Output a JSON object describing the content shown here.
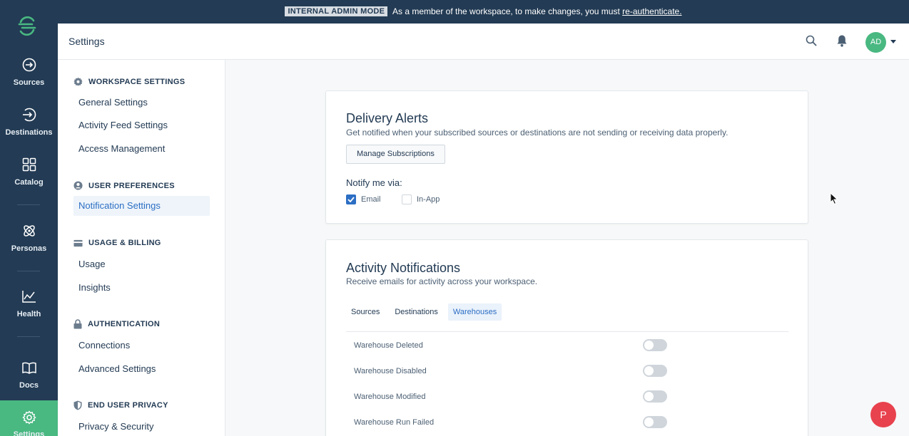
{
  "banner": {
    "mode": "INTERNAL ADMIN MODE",
    "message": "As a member of the workspace, to make changes, you must",
    "link": "re-authenticate."
  },
  "rail": {
    "items": [
      {
        "label": "Sources",
        "icon": "sources-icon"
      },
      {
        "label": "Destinations",
        "icon": "destinations-icon"
      },
      {
        "label": "Catalog",
        "icon": "catalog-icon"
      },
      {
        "label": "Personas",
        "icon": "personas-icon"
      },
      {
        "label": "Health",
        "icon": "health-icon"
      },
      {
        "label": "Docs",
        "icon": "docs-icon"
      },
      {
        "label": "Settings",
        "icon": "gear-icon"
      }
    ],
    "active_color": "#49b881"
  },
  "header": {
    "title": "Settings",
    "avatar_initials": "AD"
  },
  "sidebar": {
    "sections": [
      {
        "title": "WORKSPACE SETTINGS",
        "links": [
          "General Settings",
          "Activity Feed Settings",
          "Access Management"
        ]
      },
      {
        "title": "USER PREFERENCES",
        "links": [
          "Notification Settings"
        ]
      },
      {
        "title": "USAGE & BILLING",
        "links": [
          "Usage",
          "Insights"
        ]
      },
      {
        "title": "AUTHENTICATION",
        "links": [
          "Connections",
          "Advanced Settings"
        ]
      },
      {
        "title": "END USER PRIVACY",
        "links": [
          "Privacy & Security"
        ]
      }
    ],
    "active_link": "Notification Settings"
  },
  "delivery": {
    "title": "Delivery Alerts",
    "description": "Get notified when your subscribed sources or destinations are not sending or receiving data properly.",
    "button": "Manage Subscriptions",
    "notify_label": "Notify me via:",
    "options": [
      {
        "label": "Email",
        "checked": true
      },
      {
        "label": "In-App",
        "checked": false
      }
    ]
  },
  "activity": {
    "title": "Activity Notifications",
    "description": "Receive emails for activity across your workspace.",
    "tabs": [
      "Sources",
      "Destinations",
      "Warehouses"
    ],
    "active_tab": "Warehouses",
    "rows": [
      {
        "label": "Warehouse Deleted",
        "enabled": false
      },
      {
        "label": "Warehouse Disabled",
        "enabled": false
      },
      {
        "label": "Warehouse Modified",
        "enabled": false
      },
      {
        "label": "Warehouse Run Failed",
        "enabled": false
      }
    ]
  },
  "fab": {
    "label": "P",
    "color": "#e8424e"
  }
}
